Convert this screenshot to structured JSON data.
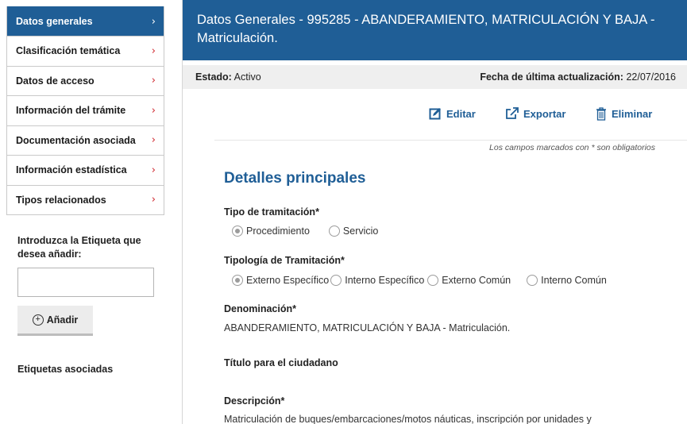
{
  "sidebar": {
    "items": [
      {
        "label": "Datos generales",
        "active": true
      },
      {
        "label": "Clasificación temática"
      },
      {
        "label": "Datos de acceso"
      },
      {
        "label": "Información del trámite"
      },
      {
        "label": "Documentación asociada"
      },
      {
        "label": "Información estadística"
      },
      {
        "label": "Tipos relacionados"
      }
    ],
    "chevron": "›",
    "tag_prompt": "Introduzca la Etiqueta que desea añadir:",
    "tag_input_value": "",
    "add_button_label": "Añadir",
    "add_button_icon": "plus-circle-icon",
    "associated_tags_label": "Etiquetas asociadas"
  },
  "header": {
    "title": "Datos Generales - 995285 - ABANDERAMIENTO, MATRICULACIÓN Y BAJA - Matriculación."
  },
  "status": {
    "state_label": "Estado:",
    "state_value": "Activo",
    "updated_label": "Fecha de última actualización:",
    "updated_value": "22/07/2016"
  },
  "toolbar": {
    "edit_label": "Editar",
    "export_label": "Exportar",
    "delete_label": "Eliminar"
  },
  "required_note": "Los campos marcados con * son obligatorios",
  "details": {
    "section_title": "Detalles principales",
    "tipo_tramitacion": {
      "label": "Tipo de tramitación*",
      "options": [
        {
          "label": "Procedimiento",
          "checked": true
        },
        {
          "label": "Servicio",
          "checked": false
        }
      ]
    },
    "tipologia": {
      "label": "Tipología de Tramitación*",
      "options": [
        {
          "label": "Externo Específico",
          "checked": true
        },
        {
          "label": "Interno Específico",
          "checked": false
        },
        {
          "label": "Externo Común",
          "checked": false
        },
        {
          "label": "Interno Común",
          "checked": false
        }
      ]
    },
    "denominacion": {
      "label": "Denominación*",
      "value": "ABANDERAMIENTO, MATRICULACIÓN Y BAJA - Matriculación."
    },
    "titulo_ciudadano": {
      "label": "Título para el ciudadano",
      "value": ""
    },
    "descripcion": {
      "label": "Descripción*",
      "value": "Matriculación de buques/embarcaciones/motos náuticas, inscripción por unidades y"
    }
  },
  "colors": {
    "primary": "#1f5e96",
    "chevron_red": "#d0262d",
    "status_bg": "#efefef"
  }
}
